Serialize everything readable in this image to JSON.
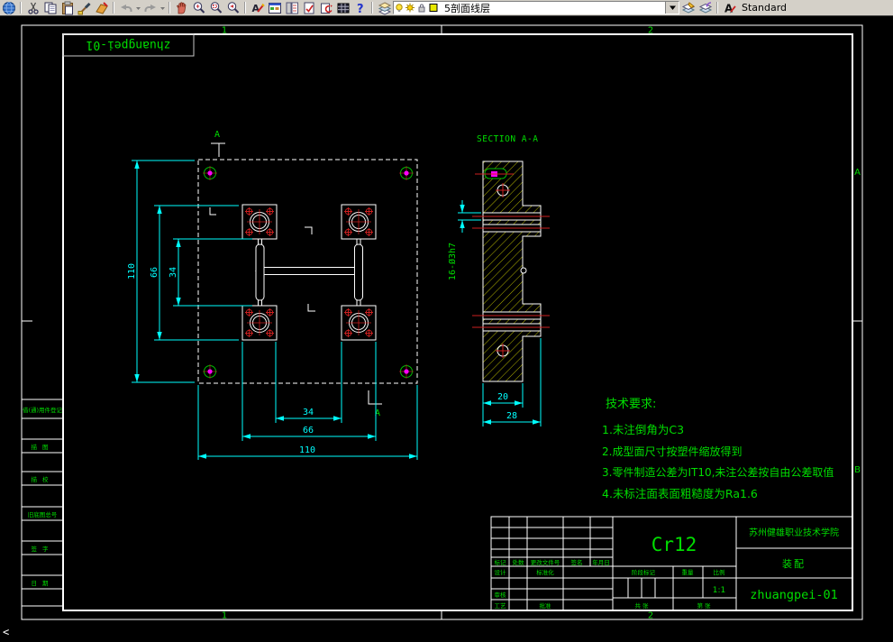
{
  "toolbar": {
    "layer_combo_value": "5剖面线层",
    "text_style_value": "Standard"
  },
  "sheet": {
    "zone_top_left": "1",
    "zone_top_right": "2",
    "zone_bottom_left": "1",
    "zone_bottom_right": "2",
    "zone_right_upper": "A",
    "zone_right_lower": "B",
    "stamp_text": "zhuangpei-01"
  },
  "plan_view": {
    "cut_label_top": "A",
    "cut_label_bottom": "A",
    "dim_height_110": "110",
    "dim_height_66": "66",
    "dim_height_34": "34",
    "dim_width_34": "34",
    "dim_width_66": "66",
    "dim_width_110": "110"
  },
  "section_view": {
    "title": "SECTION A-A",
    "dim_holes": "16-Ø3h7",
    "dim_20": "20",
    "dim_28": "28"
  },
  "tech_requirements": {
    "title": "技术要求:",
    "items": [
      "1.未注倒角为C3",
      "2.成型面尺寸按塑件缩放得到",
      "3.零件制造公差为IT10,未注公差按自由公差取值",
      "4.未标注面表面粗糙度为Ra1.6"
    ]
  },
  "title_block": {
    "material": "Cr12",
    "company": "苏州健雄职业技术学院",
    "part_name": "装配",
    "drawing_number": "zhuangpei-01",
    "scale_value": "1:1",
    "labels": {
      "mark": "标记",
      "count": "处数",
      "change_file": "更改文件号",
      "sign": "签名",
      "date": "年月日",
      "design": "设计",
      "standard": "标准化",
      "stage": "阶段标记",
      "weight": "重量",
      "scale": "比例",
      "audit": "审核",
      "craft": "工艺",
      "approve": "批准",
      "sheets": "共  张",
      "page": "第  张"
    }
  },
  "margin_column": {
    "items": [
      "借(通)用件登记",
      "描图",
      "描校",
      "旧底图总号",
      "签字",
      "日期"
    ]
  },
  "status": {
    "prompt": "<"
  }
}
